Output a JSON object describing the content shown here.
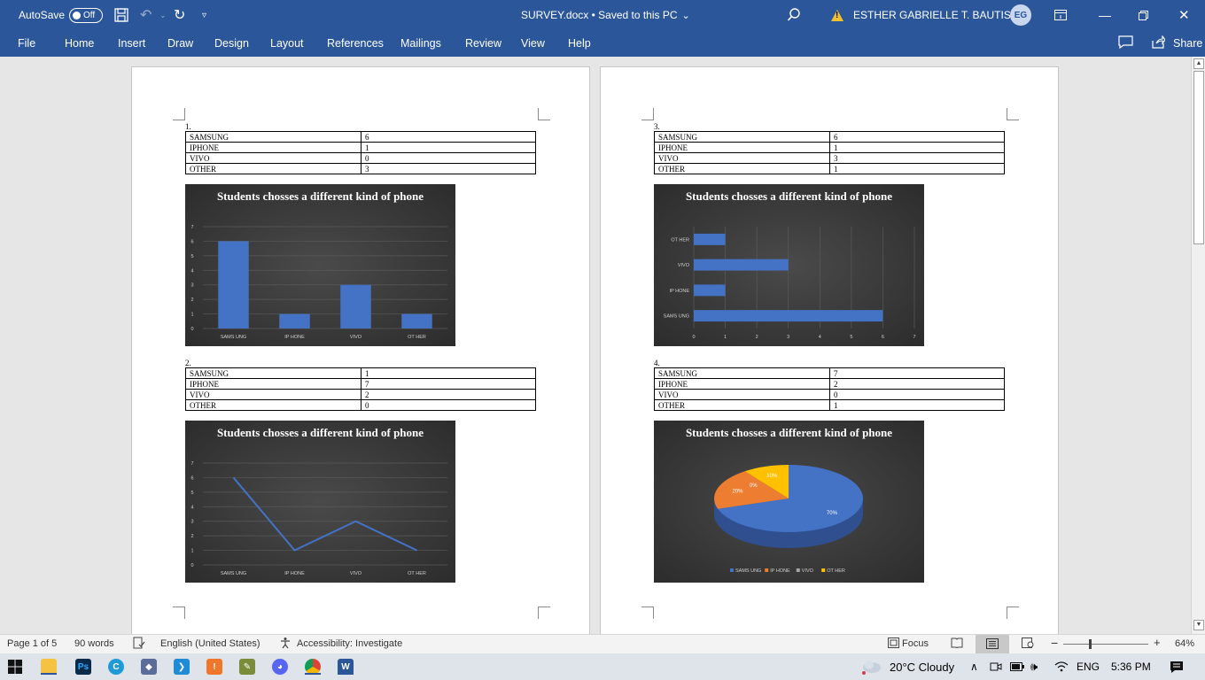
{
  "titlebar": {
    "autosave_label": "AutoSave",
    "autosave_state": "Off",
    "doc_title": "SURVEY.docx • Saved to this PC",
    "user_name": "ESTHER GABRIELLE T. BAUTISTA",
    "user_initials": "EG"
  },
  "ribbon": {
    "tabs": [
      "File",
      "Home",
      "Insert",
      "Draw",
      "Design",
      "Layout",
      "References",
      "Mailings",
      "Review",
      "View",
      "Help"
    ],
    "share_label": "Share"
  },
  "sections": [
    {
      "number": "1.",
      "rows": [
        [
          "SAMSUNG",
          "6"
        ],
        [
          "IPHONE",
          "1"
        ],
        [
          "VIVO",
          "0"
        ],
        [
          "OTHER",
          "3"
        ]
      ]
    },
    {
      "number": "2.",
      "rows": [
        [
          "SAMSUNG",
          "1"
        ],
        [
          "IPHONE",
          "7"
        ],
        [
          "VIVO",
          "2"
        ],
        [
          "OTHER",
          "0"
        ]
      ]
    },
    {
      "number": "3.",
      "rows": [
        [
          "SAMSUNG",
          "6"
        ],
        [
          "IPHONE",
          "1"
        ],
        [
          "VIVO",
          "3"
        ],
        [
          "OTHER",
          "1"
        ]
      ]
    },
    {
      "number": "4.",
      "rows": [
        [
          "SAMSUNG",
          "7"
        ],
        [
          "IPHONE",
          "2"
        ],
        [
          "VIVO",
          "0"
        ],
        [
          "OTHER",
          "1"
        ]
      ]
    }
  ],
  "chart_data": [
    {
      "type": "bar",
      "title": "Students chosses a different kind of phone",
      "categories": [
        "SAMSUNG",
        "IPHONE",
        "VIVO",
        "OTHER"
      ],
      "values": [
        6,
        1,
        3,
        1
      ],
      "ylim": [
        0,
        7
      ],
      "grid": true,
      "color": "#4472c4"
    },
    {
      "type": "line",
      "title": "Students chosses a different kind of phone",
      "categories": [
        "SAMSUNG",
        "IPHONE",
        "VIVO",
        "OTHER"
      ],
      "values": [
        6,
        1,
        3,
        1
      ],
      "ylim": [
        0,
        7
      ],
      "grid": true,
      "color": "#4472c4"
    },
    {
      "type": "bar",
      "orientation": "horizontal",
      "title": "Students chosses a different kind of phone",
      "categories": [
        "SAMSUNG",
        "IPHONE",
        "VIVO",
        "OTHER"
      ],
      "values": [
        6,
        1,
        3,
        1
      ],
      "xlim": [
        0,
        7
      ],
      "grid": true,
      "color": "#4472c4"
    },
    {
      "type": "pie",
      "title": "Students chosses a different kind of phone",
      "categories": [
        "SAMSUNG",
        "IPHONE",
        "VIVO",
        "OTHER"
      ],
      "values": [
        70,
        20,
        0,
        10
      ],
      "labels": [
        "70%",
        "20%",
        "0%",
        "10%"
      ],
      "colors": [
        "#4472c4",
        "#ed7d31",
        "#a5a5a5",
        "#ffc000"
      ],
      "legend": "bottom"
    }
  ],
  "statusbar": {
    "page": "Page 1 of 5",
    "words": "90 words",
    "language": "English (United States)",
    "accessibility": "Accessibility: Investigate",
    "focus": "Focus",
    "zoom": "64%"
  },
  "taskbar": {
    "weather": "20°C  Cloudy",
    "lang": "ENG",
    "time": "5:36 PM"
  }
}
